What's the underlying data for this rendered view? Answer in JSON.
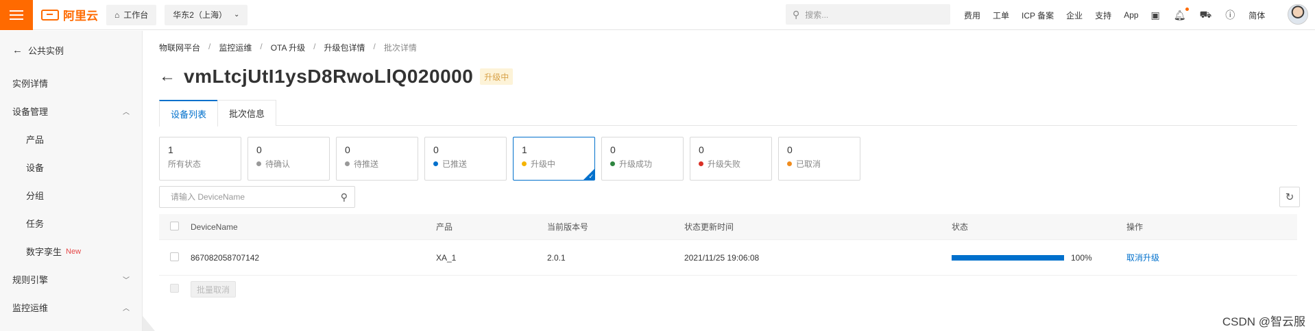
{
  "topbar": {
    "brand": "阿里云",
    "workbench": "工作台",
    "region": "华东2（上海）",
    "search_placeholder": "搜索...",
    "links": [
      "费用",
      "工单",
      "ICP 备案",
      "企业",
      "支持",
      "App"
    ],
    "lang": "简体",
    "icons": [
      "terminal-icon",
      "bell-icon",
      "cart-icon",
      "help-icon"
    ]
  },
  "sidebar": {
    "back_label": "公共实例",
    "items": [
      {
        "label": "实例详情",
        "level": 0
      },
      {
        "label": "设备管理",
        "level": 0,
        "chevron": "up"
      },
      {
        "label": "产品",
        "level": 1
      },
      {
        "label": "设备",
        "level": 1
      },
      {
        "label": "分组",
        "level": 1
      },
      {
        "label": "任务",
        "level": 1
      },
      {
        "label": "数字孪生",
        "level": 1,
        "badge": "New"
      },
      {
        "label": "规则引擎",
        "level": 0,
        "chevron": "down"
      },
      {
        "label": "监控运维",
        "level": 0,
        "chevron": "up"
      }
    ]
  },
  "breadcrumb": [
    "物联网平台",
    "监控运维",
    "OTA 升级",
    "升级包详情",
    "批次详情"
  ],
  "page": {
    "title": "vmLtcjUtI1ysD8RwoLlQ020000",
    "status": "升级中"
  },
  "tabs": [
    {
      "label": "设备列表",
      "active": true
    },
    {
      "label": "批次信息",
      "active": false
    }
  ],
  "status_cards": [
    {
      "count": "1",
      "label": "所有状态",
      "dot": null,
      "active": false
    },
    {
      "count": "0",
      "label": "待确认",
      "dot": "#999999",
      "active": false
    },
    {
      "count": "0",
      "label": "待推送",
      "dot": "#999999",
      "active": false
    },
    {
      "count": "0",
      "label": "已推送",
      "dot": "#0070cc",
      "active": false
    },
    {
      "count": "1",
      "label": "升级中",
      "dot": "#f5b400",
      "active": true
    },
    {
      "count": "0",
      "label": "升级成功",
      "dot": "#2e8540",
      "active": false
    },
    {
      "count": "0",
      "label": "升级失败",
      "dot": "#d93026",
      "active": false
    },
    {
      "count": "0",
      "label": "已取消",
      "dot": "#f08c1e",
      "active": false
    }
  ],
  "search": {
    "placeholder": "请输入 DeviceName"
  },
  "table": {
    "headers": [
      "DeviceName",
      "产品",
      "当前版本号",
      "状态更新时间",
      "状态",
      "操作"
    ],
    "rows": [
      {
        "device": "867082058707142",
        "product": "XA_1",
        "version": "2.0.1",
        "time": "2021/11/25 19:06:08",
        "progress": 100,
        "progress_label": "100%",
        "action": "取消升级"
      }
    ],
    "batch_cancel": "批量取消"
  },
  "watermark": "CSDN @智云服",
  "colors": {
    "accent": "#ff6a00",
    "primary": "#0070cc"
  }
}
